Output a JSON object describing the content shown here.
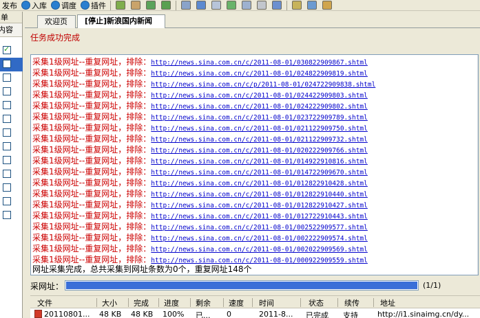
{
  "toolbar": {
    "publish_label": "发布",
    "store_label": "入库",
    "schedule_label": "调度",
    "plugin_label": "插件"
  },
  "left_panel": {
    "header_top": "单",
    "header_col": "内容"
  },
  "tabs": [
    {
      "label": "欢迎页"
    },
    {
      "label": "[停止]新浪国内新闻"
    }
  ],
  "status_text": "任务成功完成",
  "log": {
    "prefix": "采集1级网址--重复网址，排除：",
    "urls": [
      "http://news.sina.com.cn/c/2011-08-01/030822909867.shtml",
      "http://news.sina.com.cn/c/2011-08-01/024822909819.shtml",
      "http://news.sina.com.cn/c/p/2011-08-01/024722909838.shtml",
      "http://news.sina.com.cn/c/2011-08-01/024422909803.shtml",
      "http://news.sina.com.cn/c/2011-08-01/024222909802.shtml",
      "http://news.sina.com.cn/c/2011-08-01/023722909789.shtml",
      "http://news.sina.com.cn/c/2011-08-01/021122909750.shtml",
      "http://news.sina.com.cn/c/2011-08-01/021122909732.shtml",
      "http://news.sina.com.cn/c/2011-08-01/020222909766.shtml",
      "http://news.sina.com.cn/c/2011-08-01/014922910816.shtml",
      "http://news.sina.com.cn/c/2011-08-01/014722909670.shtml",
      "http://news.sina.com.cn/c/2011-08-01/012822910428.shtml",
      "http://news.sina.com.cn/c/2011-08-01/012822910440.shtml",
      "http://news.sina.com.cn/c/2011-08-01/012822910427.shtml",
      "http://news.sina.com.cn/c/2011-08-01/012722910443.shtml",
      "http://news.sina.com.cn/c/2011-08-01/002522909577.shtml",
      "http://news.sina.com.cn/c/2011-08-01/002222909574.shtml",
      "http://news.sina.com.cn/c/2011-08-01/002022909569.shtml",
      "http://news.sina.com.cn/c/2011-08-01/000922909559.shtml"
    ],
    "summary": "网址采集完成，总共采集到网址条数为0个，重复网址148个"
  },
  "progress": {
    "label": "采网址：",
    "fraction": 1.0,
    "count_text": "(1/1)"
  },
  "download_table": {
    "headers": [
      "文件",
      "大小",
      "完成",
      "进度",
      "剩余",
      "速度",
      "时间",
      "状态",
      "续传",
      "地址"
    ],
    "row": [
      "20110801...",
      "48 KB",
      "48 KB",
      "100%",
      "已...",
      "0",
      "2011-8...",
      "已完成",
      "支持",
      "http://i1.sinaimg.cn/dy..."
    ]
  },
  "colors": {
    "error_red": "#cc0000",
    "link_blue": "#0000cc",
    "progress_blue": "#3a6fd8",
    "selection_blue": "#316ac5"
  }
}
